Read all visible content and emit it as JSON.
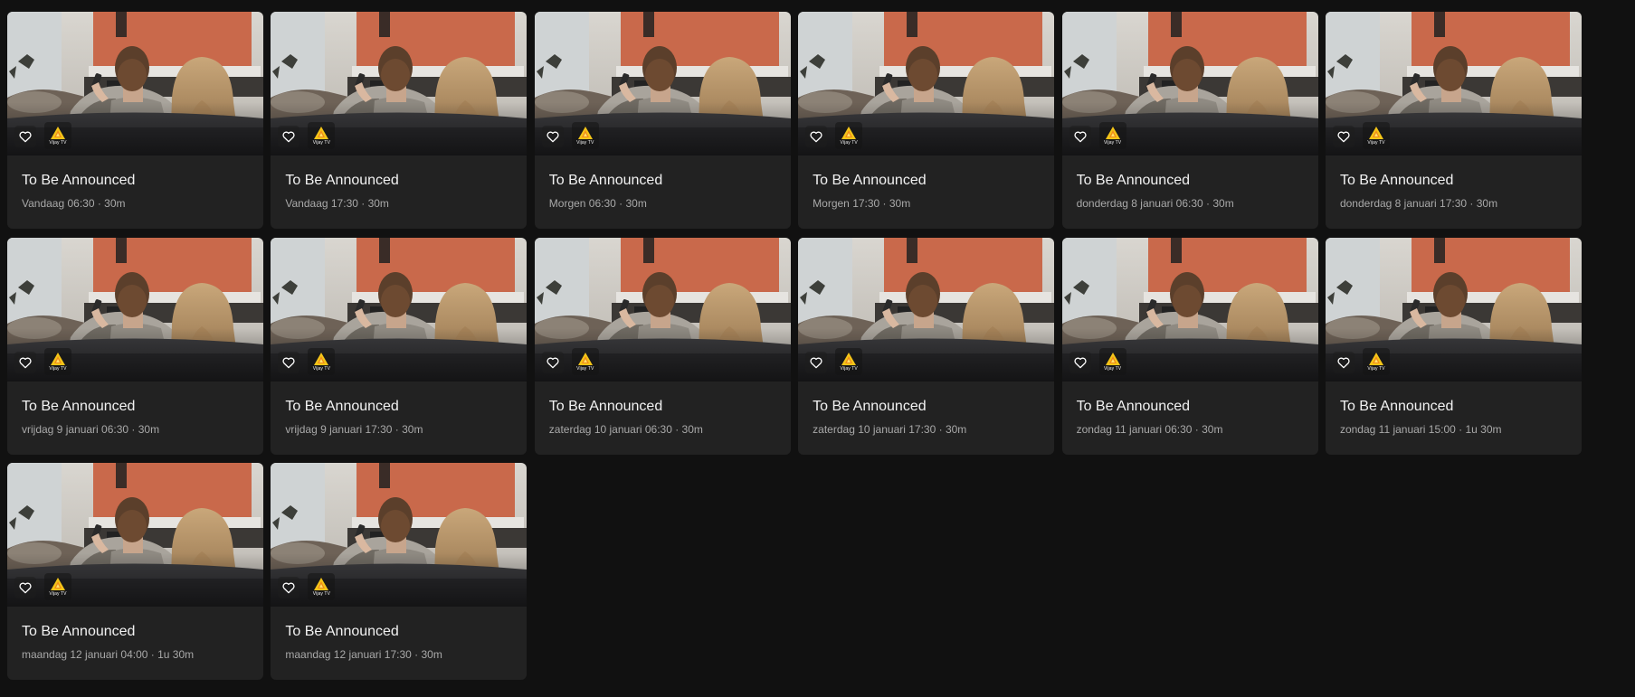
{
  "colors": {
    "background": "#111111",
    "card": "#222222",
    "title": "#f2f2f2",
    "meta": "#a9a9a9",
    "logo_accent": "#f5c518"
  },
  "icons": {
    "favorite": "heart-outline-icon",
    "channel_logo": "vijay-tv-logo"
  },
  "cards": [
    {
      "title": "To Be Announced",
      "meta": "Vandaag 06:30 · 30m",
      "channel": "Vijay TV"
    },
    {
      "title": "To Be Announced",
      "meta": "Vandaag 17:30 · 30m",
      "channel": "Vijay TV"
    },
    {
      "title": "To Be Announced",
      "meta": "Morgen 06:30 · 30m",
      "channel": "Vijay TV"
    },
    {
      "title": "To Be Announced",
      "meta": "Morgen 17:30 · 30m",
      "channel": "Vijay TV"
    },
    {
      "title": "To Be Announced",
      "meta": "donderdag 8 januari 06:30 · 30m",
      "channel": "Vijay TV"
    },
    {
      "title": "To Be Announced",
      "meta": "donderdag 8 januari 17:30 · 30m",
      "channel": "Vijay TV"
    },
    {
      "title": "To Be Announced",
      "meta": "vrijdag 9 januari 06:30 · 30m",
      "channel": "Vijay TV"
    },
    {
      "title": "To Be Announced",
      "meta": "vrijdag 9 januari 17:30 · 30m",
      "channel": "Vijay TV"
    },
    {
      "title": "To Be Announced",
      "meta": "zaterdag 10 januari 06:30 · 30m",
      "channel": "Vijay TV"
    },
    {
      "title": "To Be Announced",
      "meta": "zaterdag 10 januari 17:30 · 30m",
      "channel": "Vijay TV"
    },
    {
      "title": "To Be Announced",
      "meta": "zondag 11 januari 06:30 · 30m",
      "channel": "Vijay TV"
    },
    {
      "title": "To Be Announced",
      "meta": "zondag 11 januari 15:00 · 1u 30m",
      "channel": "Vijay TV"
    },
    {
      "title": "To Be Announced",
      "meta": "maandag 12 januari 04:00 · 1u 30m",
      "channel": "Vijay TV"
    },
    {
      "title": "To Be Announced",
      "meta": "maandag 12 januari 17:30 · 30m",
      "channel": "Vijay TV"
    }
  ]
}
